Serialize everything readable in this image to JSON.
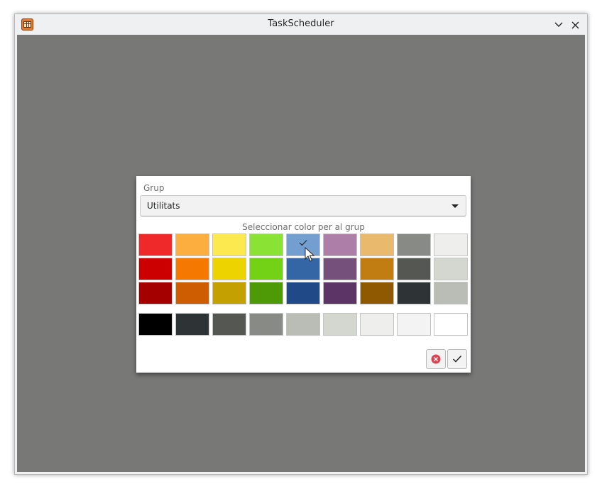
{
  "window": {
    "title": "TaskScheduler"
  },
  "icons": {
    "app": "calendar-app-icon",
    "minimize": "chevron-down-icon",
    "close": "close-icon",
    "selected": "checkmark-icon",
    "cancel": "cancel-circle-icon",
    "accept": "checkmark-icon"
  },
  "dialog": {
    "group_label": "Grup",
    "group_value": "Utilitats",
    "color_caption": "Seleccionar color per al grup",
    "palette": [
      [
        "#ef2929",
        "#fcaf3e",
        "#fce94f",
        "#8ae234",
        "#729fcf",
        "#ad7fa8",
        "#e9b96e",
        "#888a85",
        "#eeeeec"
      ],
      [
        "#cc0000",
        "#f57900",
        "#edd400",
        "#73d216",
        "#3465a4",
        "#75507b",
        "#c17d11",
        "#555753",
        "#d3d7cf"
      ],
      [
        "#a40000",
        "#ce5c00",
        "#c4a000",
        "#4e9a06",
        "#204a87",
        "#5c3566",
        "#8f5902",
        "#2e3436",
        "#babdb6"
      ]
    ],
    "grays": [
      "#000000",
      "#2e3436",
      "#555753",
      "#888a85",
      "#babdb6",
      "#d3d7cf",
      "#eeeeec",
      "#f3f3f3",
      "#ffffff"
    ],
    "selected_color": "#729fcf",
    "cancel_color": "#da4453"
  }
}
